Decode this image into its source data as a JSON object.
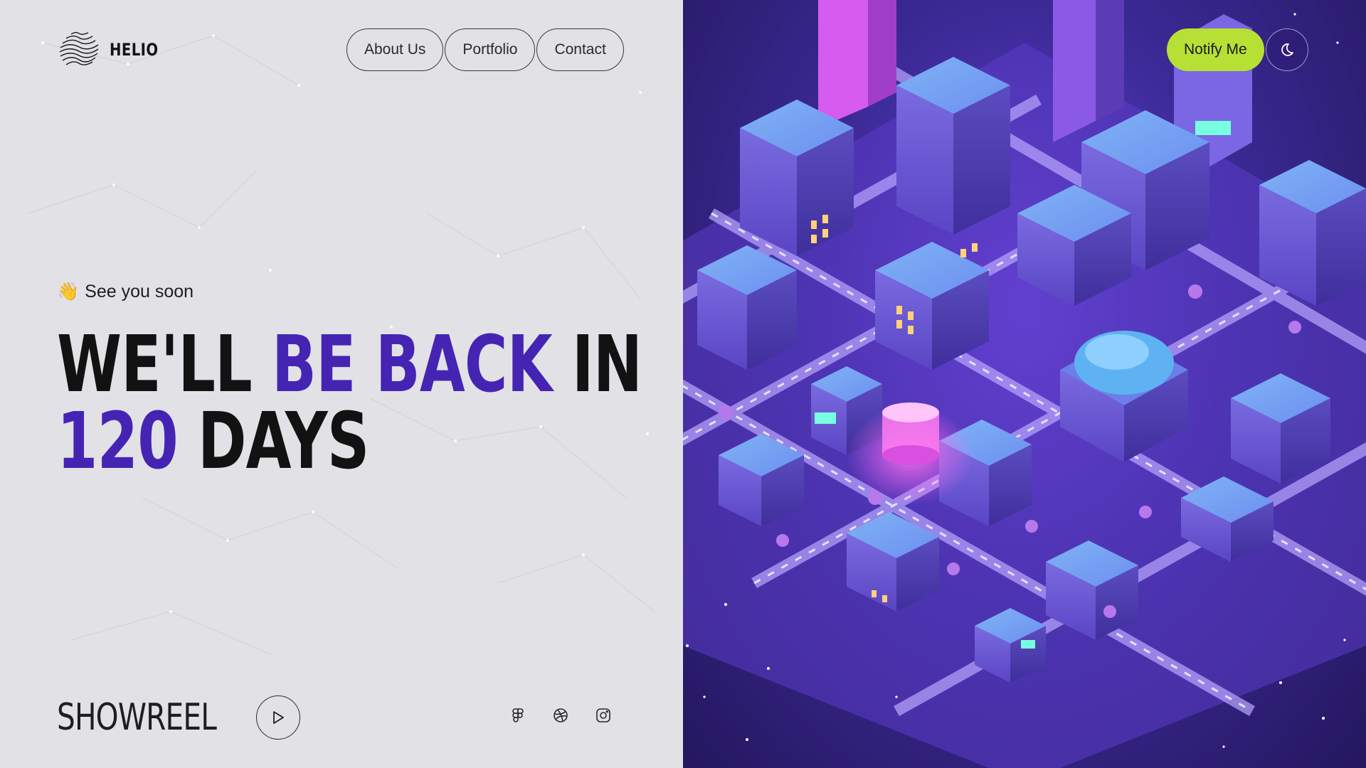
{
  "brand": {
    "name": "HELIO",
    "logo_icon": "wavy-sphere-logo-icon"
  },
  "nav": {
    "items": [
      {
        "label": "About Us"
      },
      {
        "label": "Portfolio"
      },
      {
        "label": "Contact"
      }
    ]
  },
  "header_actions": {
    "notify_label": "Notify Me",
    "theme_toggle_icon": "moon-icon",
    "accent_color": "#b6e134"
  },
  "hero": {
    "emoji": "👋",
    "subtitle": "See you soon",
    "headline": {
      "line1_part1": "WE'LL ",
      "line1_accent": "BE BACK",
      "line1_part2": " IN",
      "line2_accent": "120",
      "line2_part2": " DAYS"
    },
    "accent_color": "#4524b3"
  },
  "showreel": {
    "label": "SHOWREEL",
    "icon": "play-icon"
  },
  "socials": [
    {
      "icon": "figma-icon"
    },
    {
      "icon": "dribbble-icon"
    },
    {
      "icon": "instagram-icon"
    }
  ]
}
